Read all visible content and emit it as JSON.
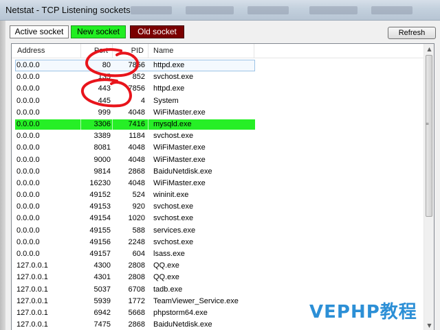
{
  "window": {
    "title": "Netstat - TCP Listening sockets"
  },
  "toolbar": {
    "active_socket_label": "Active socket",
    "new_socket_label": "New socket",
    "old_socket_label": "Old socket",
    "refresh_label": "Refresh"
  },
  "table": {
    "columns": [
      "Address",
      "Port",
      "PID",
      "Name"
    ],
    "rows": [
      {
        "address": "0.0.0.0",
        "port": "80",
        "pid": "7856",
        "name": "httpd.exe",
        "state": "selected"
      },
      {
        "address": "0.0.0.0",
        "port": "135",
        "pid": "852",
        "name": "svchost.exe",
        "state": ""
      },
      {
        "address": "0.0.0.0",
        "port": "443",
        "pid": "7856",
        "name": "httpd.exe",
        "state": ""
      },
      {
        "address": "0.0.0.0",
        "port": "445",
        "pid": "4",
        "name": "System",
        "state": ""
      },
      {
        "address": "0.0.0.0",
        "port": "999",
        "pid": "4048",
        "name": "WiFiMaster.exe",
        "state": ""
      },
      {
        "address": "0.0.0.0",
        "port": "3306",
        "pid": "7416",
        "name": "mysqld.exe",
        "state": "new"
      },
      {
        "address": "0.0.0.0",
        "port": "3389",
        "pid": "1184",
        "name": "svchost.exe",
        "state": ""
      },
      {
        "address": "0.0.0.0",
        "port": "8081",
        "pid": "4048",
        "name": "WiFiMaster.exe",
        "state": ""
      },
      {
        "address": "0.0.0.0",
        "port": "9000",
        "pid": "4048",
        "name": "WiFiMaster.exe",
        "state": ""
      },
      {
        "address": "0.0.0.0",
        "port": "9814",
        "pid": "2868",
        "name": "BaiduNetdisk.exe",
        "state": ""
      },
      {
        "address": "0.0.0.0",
        "port": "16230",
        "pid": "4048",
        "name": "WiFiMaster.exe",
        "state": ""
      },
      {
        "address": "0.0.0.0",
        "port": "49152",
        "pid": "524",
        "name": "wininit.exe",
        "state": ""
      },
      {
        "address": "0.0.0.0",
        "port": "49153",
        "pid": "920",
        "name": "svchost.exe",
        "state": ""
      },
      {
        "address": "0.0.0.0",
        "port": "49154",
        "pid": "1020",
        "name": "svchost.exe",
        "state": ""
      },
      {
        "address": "0.0.0.0",
        "port": "49155",
        "pid": "588",
        "name": "services.exe",
        "state": ""
      },
      {
        "address": "0.0.0.0",
        "port": "49156",
        "pid": "2248",
        "name": "svchost.exe",
        "state": ""
      },
      {
        "address": "0.0.0.0",
        "port": "49157",
        "pid": "604",
        "name": "lsass.exe",
        "state": ""
      },
      {
        "address": "127.0.0.1",
        "port": "4300",
        "pid": "2808",
        "name": "QQ.exe",
        "state": ""
      },
      {
        "address": "127.0.0.1",
        "port": "4301",
        "pid": "2808",
        "name": "QQ.exe",
        "state": ""
      },
      {
        "address": "127.0.0.1",
        "port": "5037",
        "pid": "6708",
        "name": "tadb.exe",
        "state": ""
      },
      {
        "address": "127.0.0.1",
        "port": "5939",
        "pid": "1772",
        "name": "TeamViewer_Service.exe",
        "state": ""
      },
      {
        "address": "127.0.0.1",
        "port": "6942",
        "pid": "5668",
        "name": "phpstorm64.exe",
        "state": ""
      },
      {
        "address": "127.0.0.1",
        "port": "7475",
        "pid": "2868",
        "name": "BaiduNetdisk.exe",
        "state": ""
      }
    ]
  },
  "scrollbar": {
    "up_icon": "scroll-up-arrow-icon",
    "down_icon": "scroll-down-arrow-icon"
  },
  "colors": {
    "new_socket": "#22ee22",
    "old_socket": "#7a0000",
    "annotation_ink": "#e8141b",
    "watermark": "#2c8fd6"
  },
  "watermark": {
    "text": "VEPHP教程"
  }
}
